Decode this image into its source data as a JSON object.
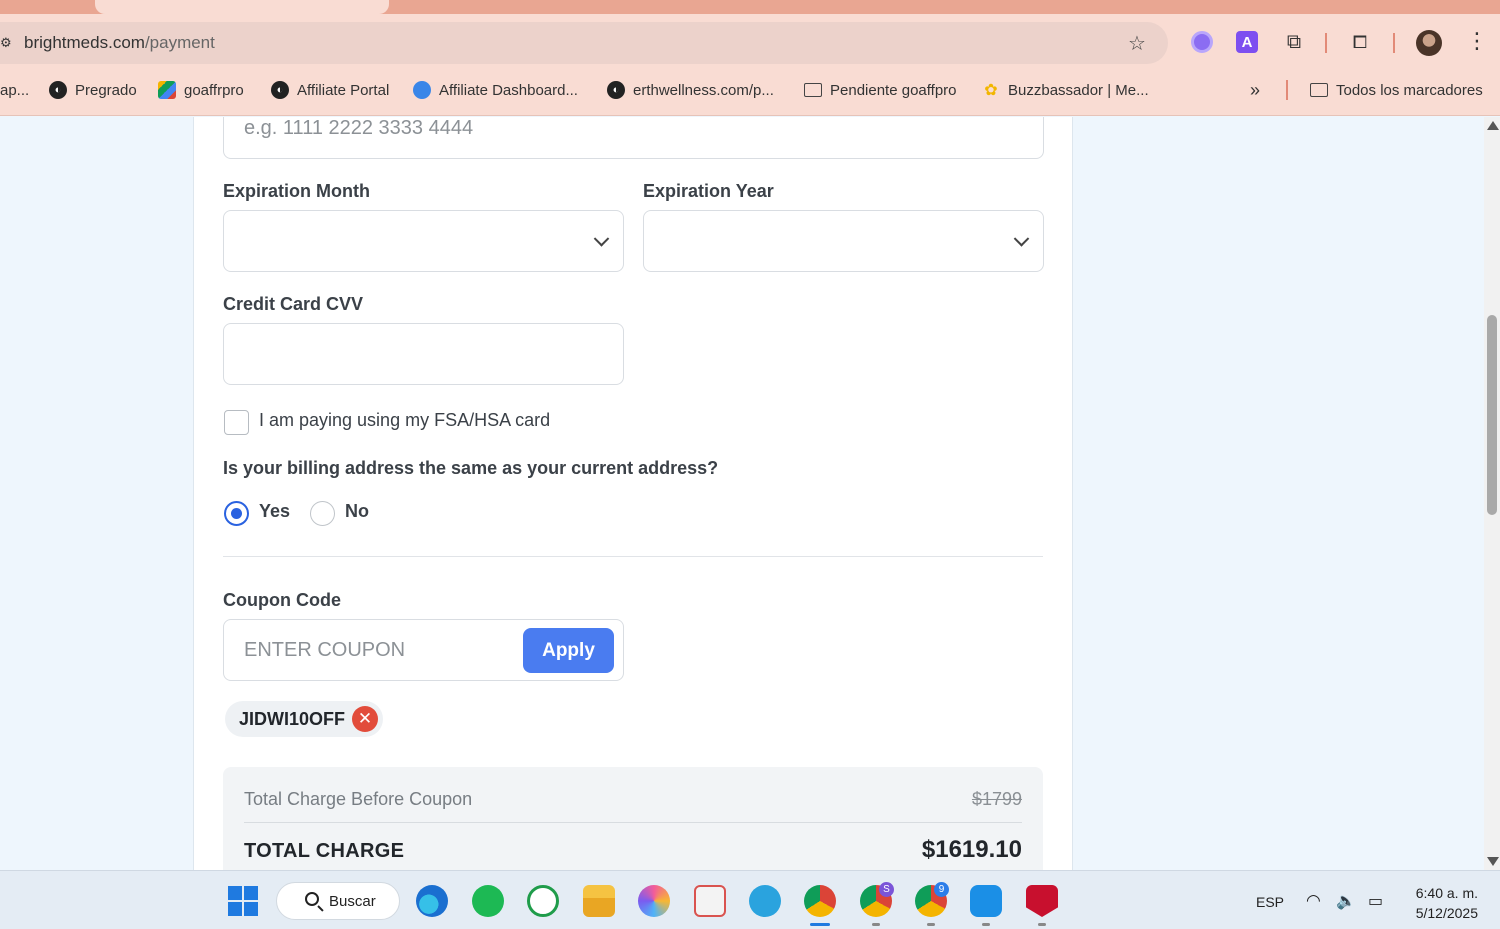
{
  "browser": {
    "url_host": "brightmeds.com",
    "url_path": "/payment",
    "bookmarks": [
      {
        "label": "ap...",
        "icon": "none"
      },
      {
        "label": "Pregrado",
        "icon": "globe-icon"
      },
      {
        "label": "goaffrpro",
        "icon": "multicolor-icon"
      },
      {
        "label": "Affiliate Portal",
        "icon": "globe-icon"
      },
      {
        "label": "Affiliate Dashboard...",
        "icon": "blue-logo-icon"
      },
      {
        "label": "erthwellness.com/p...",
        "icon": "globe-icon"
      },
      {
        "label": "Pendiente goaffpro",
        "icon": "folder-icon"
      },
      {
        "label": "Buzzbassador | Me...",
        "icon": "yellow-logo-icon"
      },
      {
        "label": "Todos los marcadores",
        "icon": "folder-icon"
      }
    ],
    "more_bookmarks": "»"
  },
  "form": {
    "card_number_placeholder": "e.g. 1111 2222 3333 4444",
    "exp_month_label": "Expiration Month",
    "exp_year_label": "Expiration Year",
    "cvv_label": "Credit Card CVV",
    "fsa_label": "I am paying using my FSA/HSA card",
    "billing_question": "Is your billing address the same as your current address?",
    "billing_yes": "Yes",
    "billing_no": "No",
    "billing_selected": "Yes",
    "coupon_label": "Coupon Code",
    "coupon_placeholder": "ENTER COUPON",
    "apply_label": "Apply",
    "applied_coupon": "JIDWI10OFF"
  },
  "summary": {
    "before_label": "Total Charge Before Coupon",
    "before_value": "$1799",
    "total_label": "TOTAL CHARGE",
    "total_value": "$1619.10"
  },
  "taskbar": {
    "search_label": "Buscar",
    "language": "ESP",
    "time": "6:40 a. m.",
    "date": "5/12/2025",
    "badges": {
      "chrome2": "S",
      "chrome3": "9"
    }
  },
  "colors": {
    "primary": "#4a7cf0",
    "radio_selected": "#2a62e0",
    "remove_coupon": "#e24c3b",
    "chrome_bg": "#f9dcd3"
  }
}
